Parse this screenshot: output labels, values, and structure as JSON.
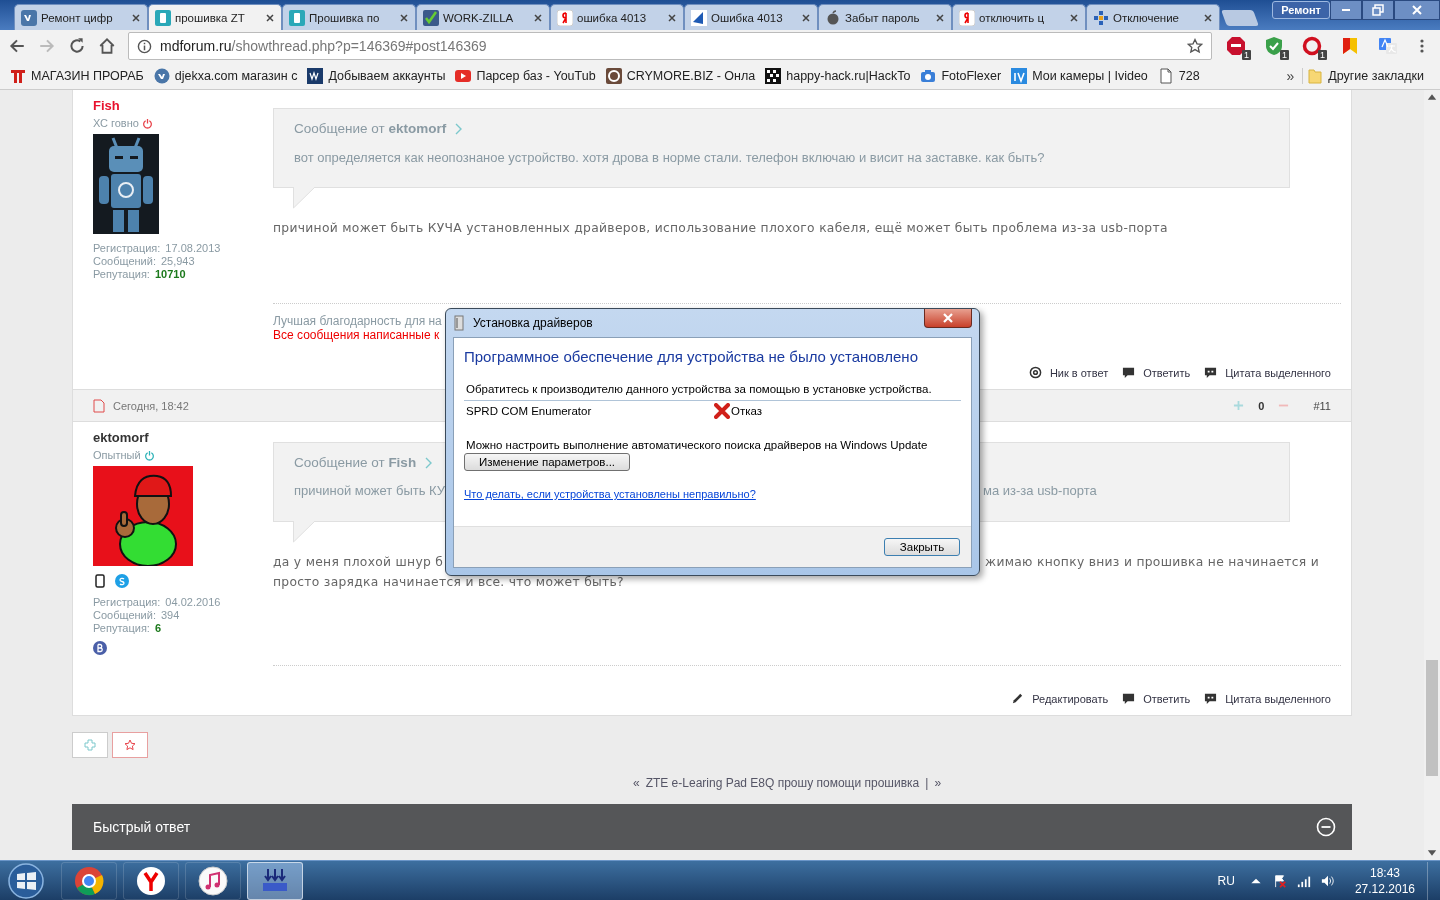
{
  "browser": {
    "tabs": [
      {
        "kind": "vk",
        "title": "Ремонт цифр",
        "selected": false
      },
      {
        "kind": "site",
        "title": "прошивка ZT",
        "selected": true
      },
      {
        "kind": "site",
        "title": "Прошивка по",
        "selected": false
      },
      {
        "kind": "check",
        "title": "WORK-ZILLA",
        "selected": false
      },
      {
        "kind": "yandex",
        "title": "ошибка 4013",
        "selected": false
      },
      {
        "kind": "blue",
        "title": "Ошибка 4013",
        "selected": false
      },
      {
        "kind": "apple",
        "title": "Забыт пароль",
        "selected": false
      },
      {
        "kind": "yandex",
        "title": "отключить ц",
        "selected": false
      },
      {
        "kind": "dots",
        "title": "Отключение",
        "selected": false
      }
    ],
    "profile_label": "Ремонт",
    "address": {
      "domain": "mdforum.ru",
      "path": "/showthread.php?p=146369#post146369"
    },
    "extensions": [
      {
        "kind": "stop",
        "badge": "1"
      },
      {
        "kind": "shield",
        "badge": "1"
      },
      {
        "kind": "ring",
        "badge": "1"
      },
      {
        "kind": "flag"
      },
      {
        "kind": "translate"
      }
    ],
    "bookmarks": [
      {
        "kind": "red",
        "title": "МАГАЗИН ПРОРАБ"
      },
      {
        "kind": "vk",
        "title": "djekxa.com магазин с"
      },
      {
        "kind": "navy",
        "title": "Добываем аккаунты"
      },
      {
        "kind": "play",
        "title": "Парсер баз - YouTub"
      },
      {
        "kind": "ring",
        "title": "CRYMORE.BIZ - Онла"
      },
      {
        "kind": "grid",
        "title": "happy-hack.ru|HackTo"
      },
      {
        "kind": "camera",
        "title": "FotoFlexer"
      },
      {
        "kind": "blue",
        "title": "Мои камеры | Ivideo"
      },
      {
        "kind": "page",
        "title": "728"
      }
    ],
    "more_bookmarks": "»",
    "other_bookmarks": "Другие закладки"
  },
  "posts": [
    {
      "user": {
        "name": "Fish",
        "color": "#e8112d",
        "title": "ХС говно",
        "online": false,
        "stats": [
          {
            "label": "Регистрация:",
            "value": "17.08.2013"
          },
          {
            "label": "Сообщений:",
            "value": "25,943"
          },
          {
            "label": "Репутация:",
            "value": "10710",
            "kind": "reputation"
          }
        ]
      },
      "quote": {
        "label": "Сообщение от **ektomorf**",
        "lines": [
          [
            "вот определяется как неопознаное устройство. хотя дрова в норме стали. телефон включаю и висит на заставке. как быть?"
          ]
        ]
      },
      "body_lines": [
        [
          "причиной может быть КУЧА установленных драйверов, использование плохого кабеля, ещё может быть проблема из-за usb-порта"
        ]
      ],
      "signature": [
        "Лучшая благодарность для на",
        "Все сообщения написанные к"
      ],
      "actions": [
        {
          "kind": "mention",
          "label": "Ник в ответ"
        },
        {
          "kind": "reply",
          "label": "Ответить"
        },
        {
          "kind": "quote",
          "label": "Цитата выделенного"
        }
      ]
    },
    {
      "header": {
        "date": "Сегодня, 18:42",
        "score": "0",
        "number": "#11"
      },
      "user": {
        "name": "ektomorf",
        "color": "#333333",
        "title": "Опытный",
        "online": true,
        "contacts": [
          {
            "kind": "phone"
          },
          {
            "kind": "skype"
          }
        ],
        "stats": [
          {
            "label": "Регистрация:",
            "value": "04.02.2016"
          },
          {
            "label": "Сообщений:",
            "value": "394"
          },
          {
            "label": "Репутация:",
            "value": "6",
            "kind": "reputation"
          }
        ],
        "badges": [
          {
            "kind": "vk"
          }
        ]
      },
      "quote": {
        "label": "Сообщение от **Fish**",
        "lines": [
          [
            "причиной может быть КУ",
            "ма из-за usb-порта"
          ]
        ]
      },
      "body_lines": [
        [
          "да у меня плохой шнур б",
          "жимаю кнопку вниз и прошивка не начинается и"
        ],
        [
          "просто зарядка начинается и все. что может быть?"
        ]
      ],
      "actions": [
        {
          "kind": "edit",
          "label": "Редактировать"
        },
        {
          "kind": "reply",
          "label": "Ответить"
        },
        {
          "kind": "quote",
          "label": "Цитата выделенного"
        }
      ]
    }
  ],
  "thread_nav": {
    "prev": "«",
    "title": "ZTE e-Learing Pad E8Q прошу помощи прошивка",
    "separator": "|",
    "next": "»"
  },
  "quick_reply": {
    "title": "Быстрый ответ"
  },
  "dialog": {
    "title": "Установка драйверов",
    "heading": "Программное обеспечение для устройства не было установлено",
    "instruction": "Обратитесь к производителю данного устройства за помощью в установке устройства.",
    "devices": [
      {
        "name": "SPRD COM Enumerator",
        "status": "Отказ",
        "failed": true
      }
    ],
    "note": "Можно настроить выполнение автоматического поиска драйверов на Windows Update",
    "settings_button": "Изменение параметров...",
    "help_link": "Что делать, если устройства установлены неправильно?",
    "close_button": "Закрыть"
  },
  "taskbar": {
    "apps": [
      {
        "kind": "chrome",
        "selected": false
      },
      {
        "kind": "yandex",
        "selected": false
      },
      {
        "kind": "music",
        "selected": false
      },
      {
        "kind": "installer",
        "selected": true
      }
    ],
    "language": "RU",
    "time": "18:43",
    "date": "27.12.2016"
  }
}
